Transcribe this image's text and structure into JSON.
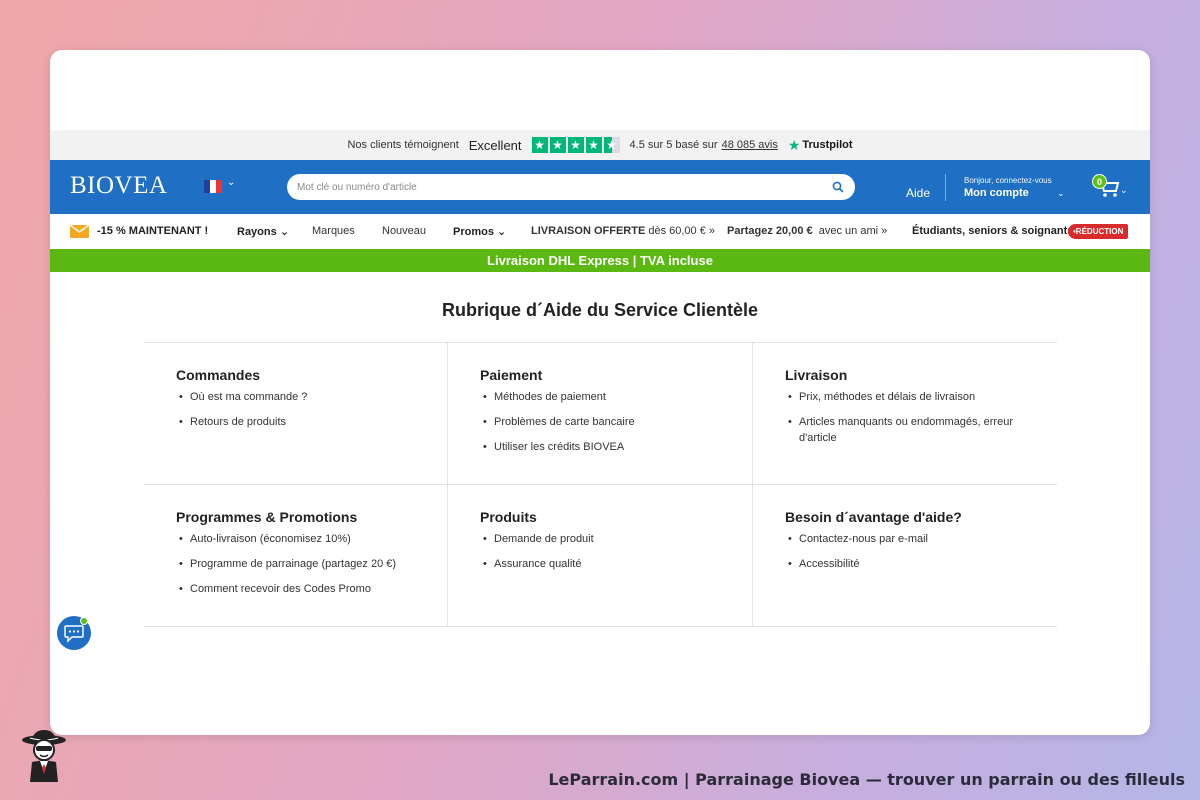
{
  "trustpilot": {
    "intro": "Nos clients témoignent",
    "rating_word": "Excellent",
    "stars": 4.5,
    "score_text": "4.5 sur 5 basé sur",
    "review_count": "48 085 avis",
    "brand": "Trustpilot",
    "color": "#00b67a"
  },
  "header": {
    "logo": "BIOVEA",
    "country_flag": "france-flag",
    "search_placeholder": "Mot clé ou numéro d'article",
    "help_label": "Aide",
    "greeting": "Bonjour, connectez-vous",
    "account_label": "Mon compte",
    "cart_count": "0",
    "bg_color": "#1f6fc4"
  },
  "nav": {
    "promo_label": "-15 % MAINTENANT !",
    "rayons": "Rayons",
    "marques": "Marques",
    "nouveau": "Nouveau",
    "promos": "Promos",
    "livraison_bold": "LIVRAISON OFFERTE",
    "livraison_rest": "dès 60,00 € »",
    "partagez_bold": "Partagez 20,00 €",
    "partagez_rest": "avec un ami »",
    "students": "Étudiants, seniors & soignants",
    "reduction_badge": "•RÉDUCTION"
  },
  "banner": {
    "text": "Livraison DHL Express | TVA incluse",
    "color": "#5bb812"
  },
  "main": {
    "title": "Rubrique d´Aide du Service Clientèle",
    "sections": [
      {
        "title": "Commandes",
        "items": [
          "Où est ma commande ?",
          "Retours de produits"
        ]
      },
      {
        "title": "Paiement",
        "items": [
          "Méthodes de paiement",
          "Problèmes de carte bancaire",
          "Utiliser les crédits BIOVEA"
        ]
      },
      {
        "title": "Livraison",
        "items": [
          "Prix, méthodes et délais de livraison",
          "Articles manquants ou endommagés, erreur d'article"
        ]
      },
      {
        "title": "Programmes & Promotions",
        "items": [
          "Auto-livraison (économisez 10%)",
          "Programme de parrainage (partagez 20 €)",
          "Comment recevoir des Codes Promo"
        ]
      },
      {
        "title": "Produits",
        "items": [
          "Demande de produit",
          "Assurance qualité"
        ]
      },
      {
        "title": "Besoin d´avantage d'aide?",
        "items": [
          "Contactez-nous par e-mail",
          "Accessibilité"
        ]
      }
    ]
  },
  "footer": {
    "caption": "LeParrain.com | Parrainage Biovea — trouver un parrain ou des filleuls"
  }
}
